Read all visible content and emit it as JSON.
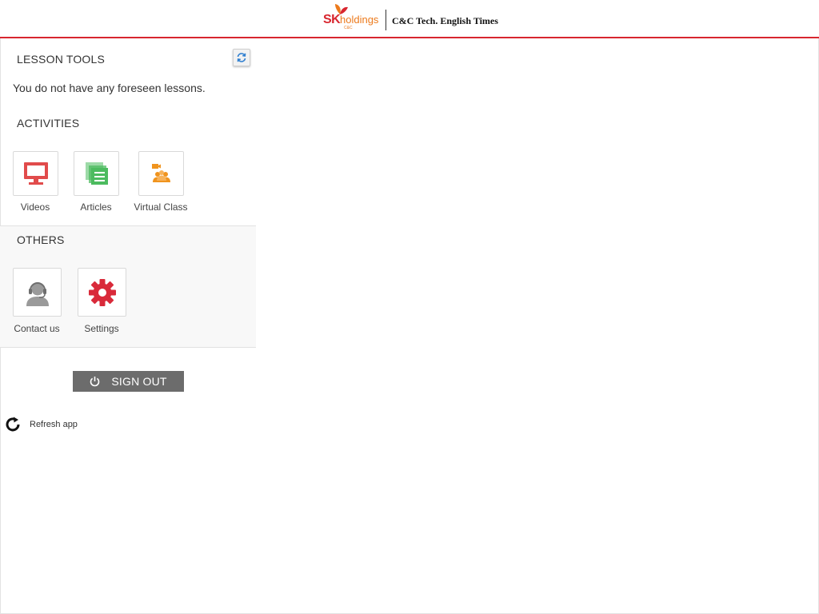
{
  "header": {
    "brand_sk": "SK",
    "brand_holdings": "holdings",
    "brand_sub": "C&C",
    "title": "C&C Tech. English Times",
    "accent_color": "#d8262f"
  },
  "lesson_tools": {
    "title": "LESSON TOOLS",
    "refresh_icon": "refresh-icon",
    "empty_message": "You do not have any foreseen lessons."
  },
  "activities": {
    "title": "ACTIVITIES",
    "items": [
      {
        "label": "Videos",
        "icon": "monitor-icon",
        "color": "#e14b4b"
      },
      {
        "label": "Articles",
        "icon": "documents-icon",
        "color": "#4cbb5f"
      },
      {
        "label": "Virtual Class",
        "icon": "virtual-class-icon",
        "color": "#f0941e"
      }
    ]
  },
  "others": {
    "title": "OTHERS",
    "items": [
      {
        "label": "Contact us",
        "icon": "headset-user-icon",
        "color": "#9a9a9a"
      },
      {
        "label": "Settings",
        "icon": "gear-icon",
        "color": "#d92a3a"
      }
    ]
  },
  "actions": {
    "sign_out": "SIGN OUT",
    "refresh_app": "Refresh app"
  }
}
